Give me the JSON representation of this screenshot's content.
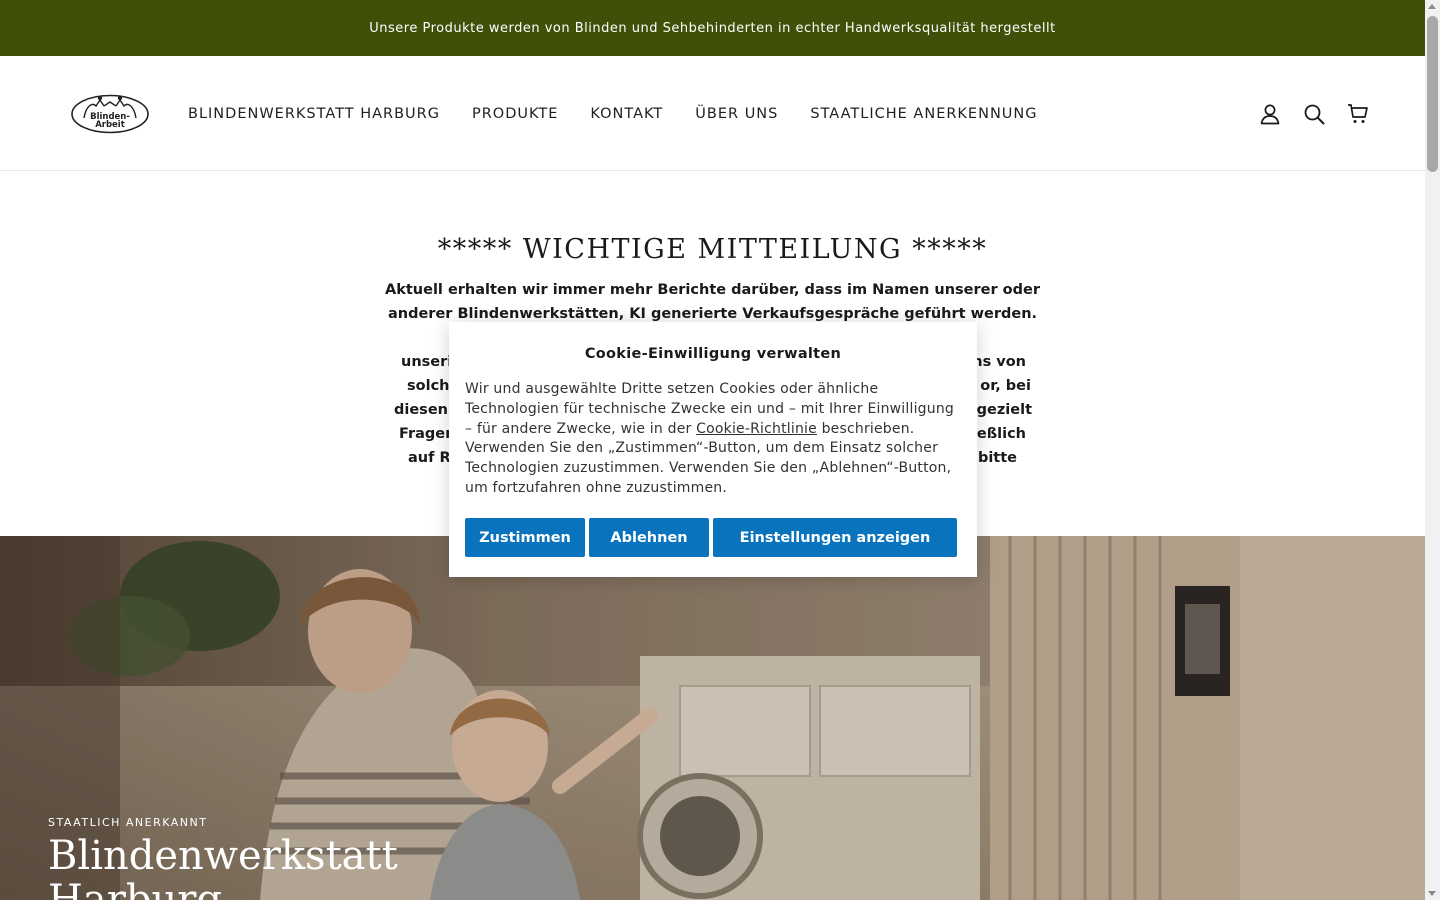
{
  "announcement": {
    "text": "Unsere Produkte werden von Blinden und Sehbehinderten in echter Handwerksqualität hergestellt"
  },
  "header": {
    "logo_text_1": "Blinden-",
    "logo_text_2": "Arbeit",
    "nav": [
      {
        "label": "BLINDENWERKSTATT HARBURG"
      },
      {
        "label": "PRODUKTE"
      },
      {
        "label": "KONTAKT"
      },
      {
        "label": "ÜBER UNS"
      },
      {
        "label": "STAATLICHE ANERKENNUNG"
      }
    ],
    "icons": [
      "account-icon",
      "search-icon",
      "cart-icon"
    ]
  },
  "notice": {
    "title": "***** WICHTIGE MITTEILUNG *****",
    "line_1": "Aktuell erhalten wir immer mehr Berichte darüber, dass im Namen unserer oder",
    "line_2": "anderer Blindenwerkstätten, KI generierte Verkaufsgespräche geführt werden. Meist",
    "line_3_start": "unseri",
    "line_3_end": "ns von",
    "line_4_start": "solche",
    "line_4_end": "or, bei",
    "line_5_start": "diesen",
    "line_5_end": "gezielt",
    "line_6_start": "Fragen",
    "line_6_end": "ießlich",
    "line_7_start": "auf Re",
    "line_7_end": "bitte"
  },
  "hero": {
    "eyebrow": "STAATLICH ANERKANNT",
    "title_line_1": "Blindenwerkstatt",
    "title_line_2": "Harburg"
  },
  "cookie": {
    "title": "Cookie-Einwilligung verwalten",
    "text_before_link": "Wir und ausgewählte Dritte setzen Cookies oder ähnliche Technologien für technische Zwecke ein und – mit Ihrer Einwilligung – für andere Zwecke, wie in der ",
    "link": "Cookie-Richtlinie",
    "text_after_link": " beschrieben. Verwenden Sie den „Zustimmen“-Button, um dem Einsatz solcher Technologien zuzustimmen. Verwenden Sie den „Ablehnen“-Button, um fortzufahren ohne zuzustimmen.",
    "buttons": {
      "accept": "Zustimmen",
      "reject": "Ablehnen",
      "settings": "Einstellungen anzeigen"
    },
    "button_color": "#0a73bd"
  },
  "colors": {
    "announcement_bg": "#3f5009",
    "text": "#1a1a1a"
  }
}
